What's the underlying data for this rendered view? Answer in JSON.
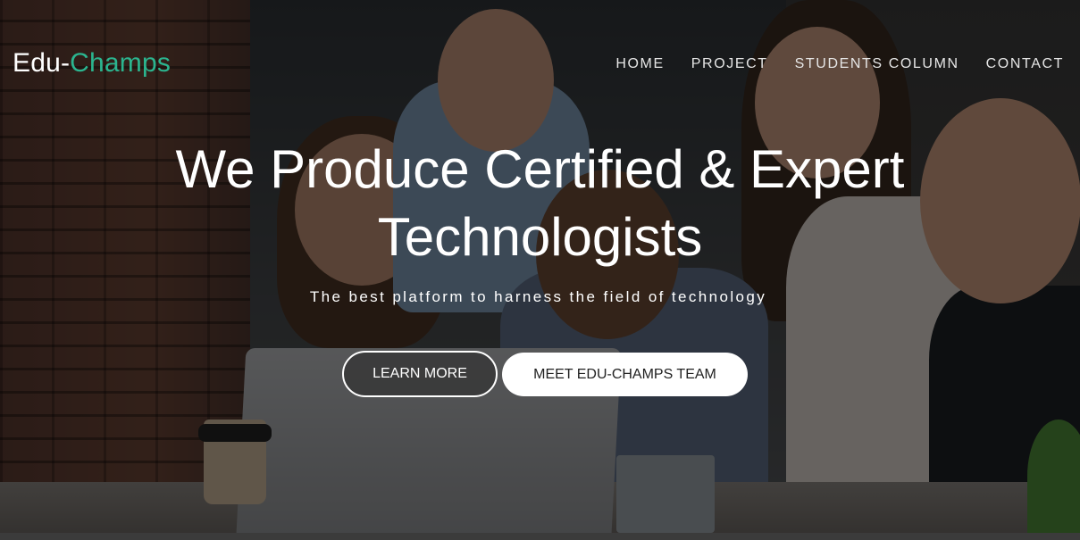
{
  "brand": {
    "prefix": "Edu-",
    "highlight": "Champs"
  },
  "nav": {
    "items": [
      {
        "label": "HOME"
      },
      {
        "label": "PROJECT"
      },
      {
        "label": "STUDENTS COLUMN"
      },
      {
        "label": "CONTACT"
      }
    ]
  },
  "hero": {
    "headline_line1": "We Produce Certified & Expert",
    "headline_line2": "Technologists",
    "subtitle": "The best platform to harness the field of technology",
    "learn_more_label": "LEARN MORE",
    "team_label": "MEET EDU-CHAMPS TEAM"
  },
  "colors": {
    "accent": "#2bb58f",
    "text": "#ffffff",
    "overlay": "rgba(0,0,0,0.52)"
  }
}
